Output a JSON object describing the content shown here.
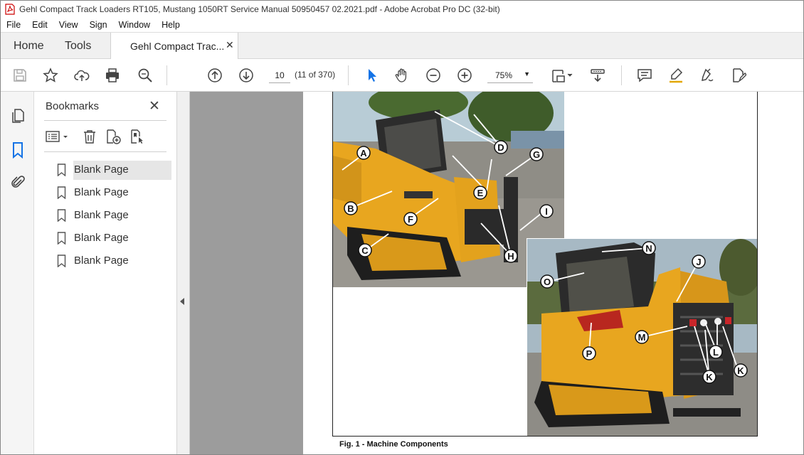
{
  "window": {
    "title": "Gehl Compact Track Loaders RT105, Mustang 1050RT Service Manual 50950457 02.2021.pdf - Adobe Acrobat Pro DC (32-bit)"
  },
  "menu": [
    "File",
    "Edit",
    "View",
    "Sign",
    "Window",
    "Help"
  ],
  "tabs": {
    "home": "Home",
    "tools": "Tools",
    "document": "Gehl Compact Trac...",
    "close_glyph": "✕"
  },
  "toolbar": {
    "page_value": "10",
    "page_count": "(11 of 370)",
    "zoom": "75%"
  },
  "bookmarks": {
    "title": "Bookmarks",
    "close_glyph": "✕",
    "items": [
      {
        "label": "Blank Page"
      },
      {
        "label": "Blank Page"
      },
      {
        "label": "Blank Page"
      },
      {
        "label": "Blank Page"
      },
      {
        "label": "Blank Page"
      }
    ]
  },
  "document": {
    "caption": "Fig. 1 -  Machine Components",
    "callouts_top": [
      "A",
      "B",
      "C",
      "D",
      "E",
      "F",
      "G",
      "H",
      "I"
    ],
    "callouts_bottom": [
      "J",
      "K",
      "K",
      "L",
      "M",
      "N",
      "O",
      "P"
    ]
  },
  "colors": {
    "accent_blue": "#1473e6",
    "machine_yellow": "#e9a820",
    "viewer_gray": "#9c9c9c"
  }
}
